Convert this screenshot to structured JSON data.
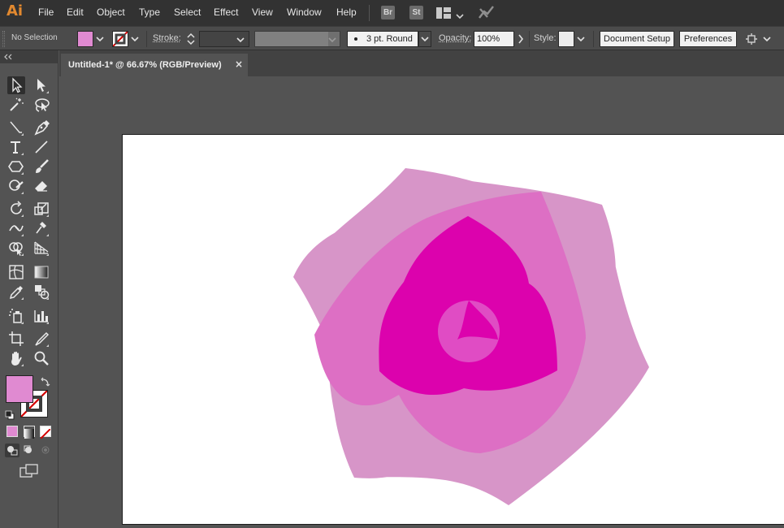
{
  "app": {
    "logo": "Ai"
  },
  "menu": [
    "File",
    "Edit",
    "Object",
    "Type",
    "Select",
    "Effect",
    "View",
    "Window",
    "Help"
  ],
  "app_badges": [
    "Br",
    "St"
  ],
  "control_bar": {
    "selection_status": "No Selection",
    "fill_color": "#e08ad1",
    "stroke_label": "Stroke:",
    "stroke_weight": "",
    "brush": "3 pt. Round",
    "opacity_label": "Opacity:",
    "opacity": "100%",
    "style_label": "Style:",
    "document_setup": "Document Setup",
    "preferences": "Preferences"
  },
  "document_tab": {
    "title": "Untitled-1* @ 66.67% (RGB/Preview)",
    "close": "×"
  },
  "tools_panel": {
    "fill_swatch": "#e08ad1",
    "stroke_swatch": "none"
  },
  "artwork": {
    "palette": {
      "outer_petals": "#d795c8",
      "middle_petals": "#dd6fc4",
      "inner_petals": "#dc02ad",
      "center": "#e04cc4"
    }
  }
}
